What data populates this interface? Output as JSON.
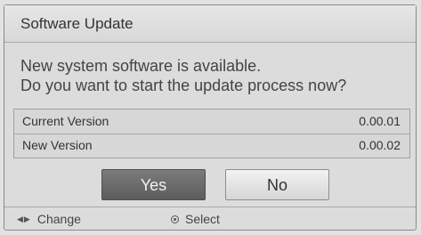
{
  "dialog": {
    "title": "Software Update",
    "message_line1": "New system software is available.",
    "message_line2": "Do you want to start the update process now?",
    "current_version_label": "Current Version",
    "current_version_value": "0.00.01",
    "new_version_label": "New Version",
    "new_version_value": "0.00.02",
    "yes_label": "Yes",
    "no_label": "No",
    "selected_button": "Yes"
  },
  "footer": {
    "change_icon": "left-right-arrows-icon",
    "change_label": "Change",
    "select_icon": "ok-button-icon",
    "select_label": "Select"
  },
  "colors": {
    "background": "#dcdcdc",
    "selected_button": "#6a6a6a",
    "unselected_button": "#e6e6e6"
  }
}
